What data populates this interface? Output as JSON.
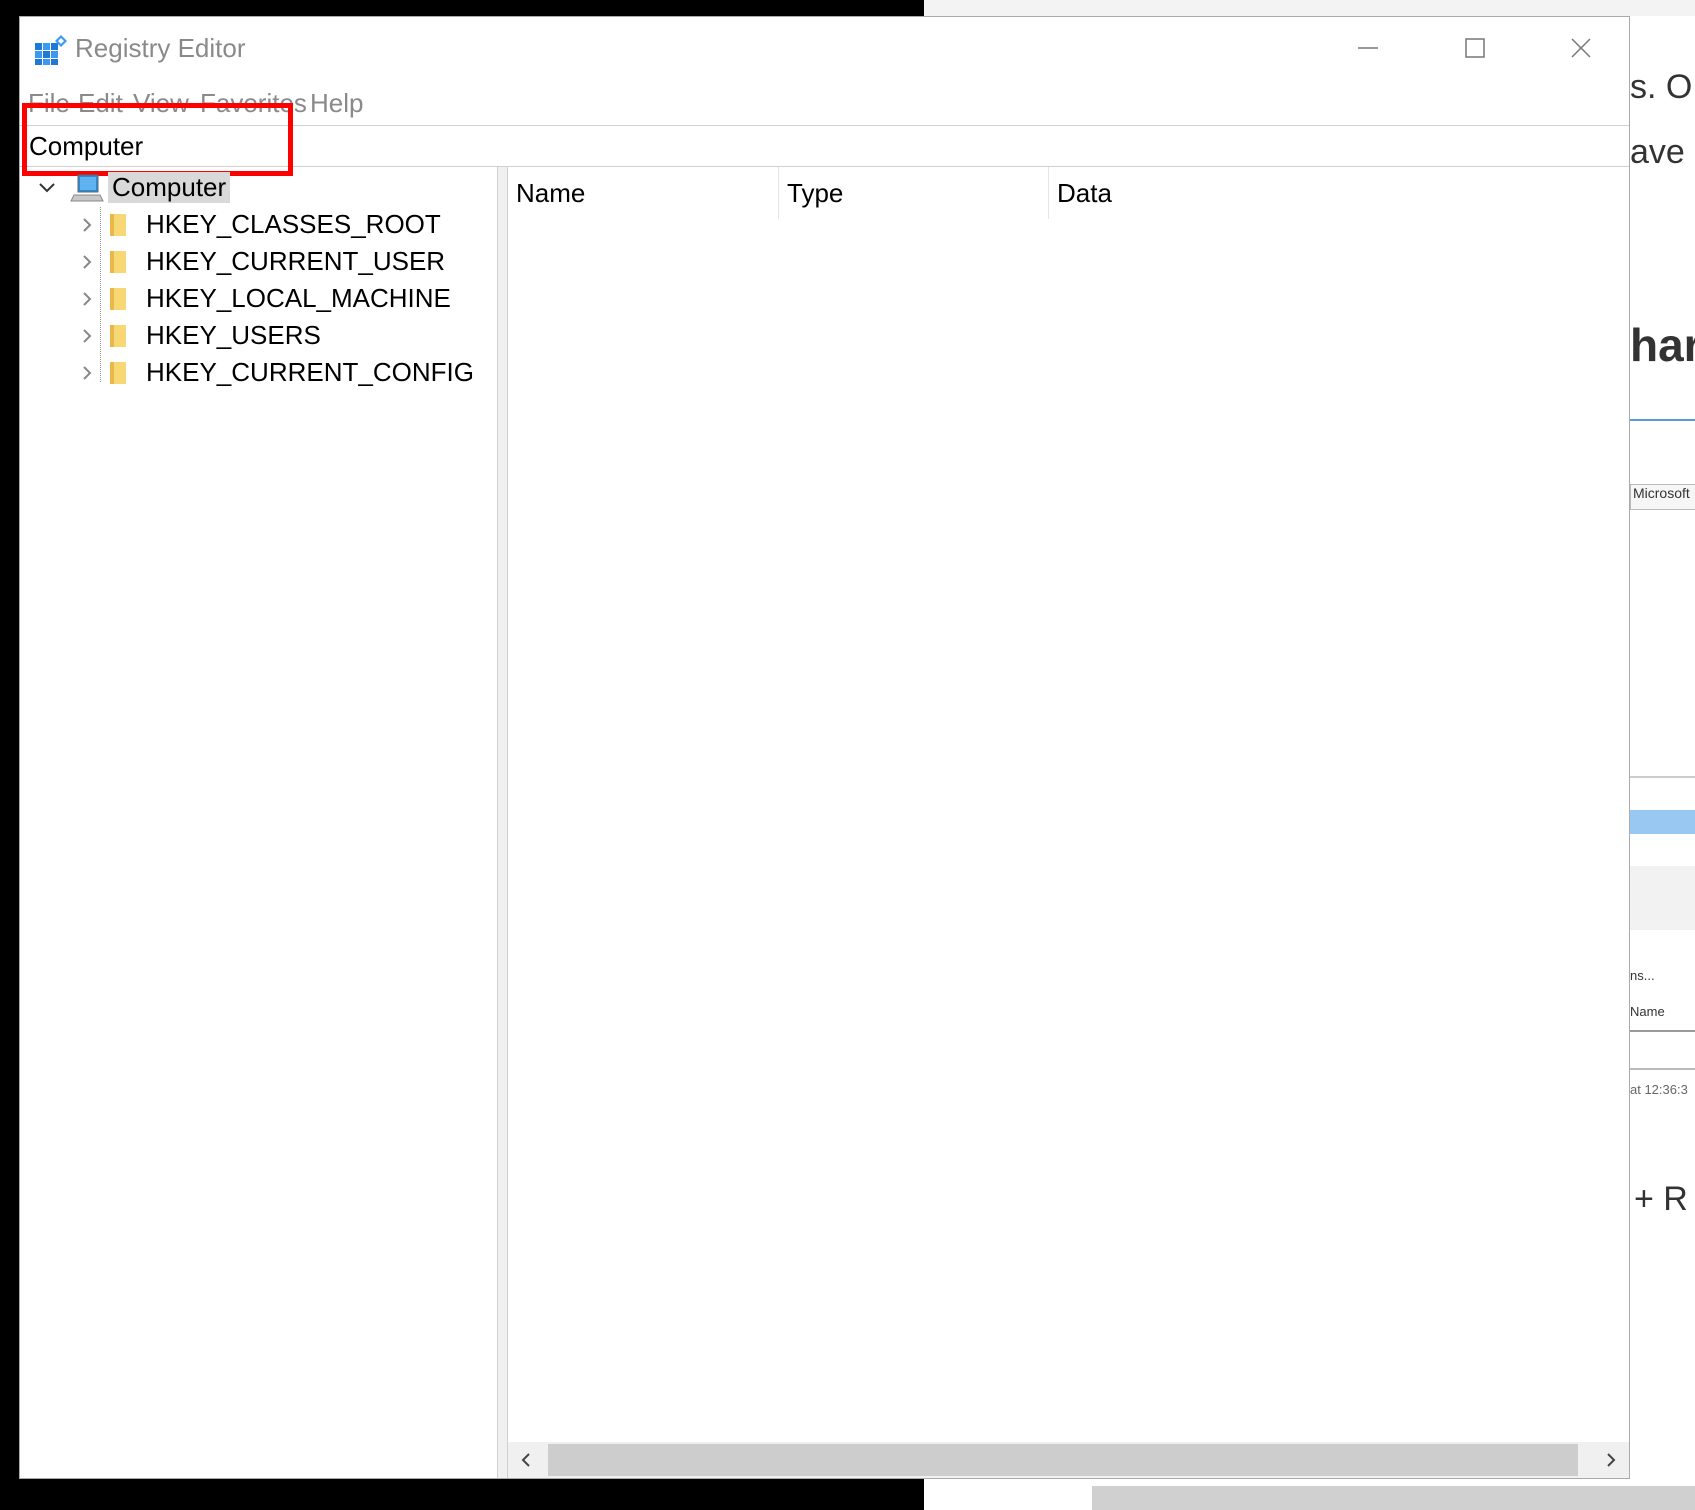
{
  "window": {
    "title": "Registry Editor"
  },
  "menu": [
    "File",
    "Edit",
    "View",
    "Favorites",
    "Help"
  ],
  "address": "Computer",
  "tree": {
    "root": "Computer",
    "children": [
      "HKEY_CLASSES_ROOT",
      "HKEY_CURRENT_USER",
      "HKEY_LOCAL_MACHINE",
      "HKEY_USERS",
      "HKEY_CURRENT_CONFIG"
    ]
  },
  "list": {
    "columns": [
      "Name",
      "Type",
      "Data"
    ]
  },
  "background": {
    "line1": "s. O",
    "line2": "ave",
    "heading": "har",
    "box": "Microsoft",
    "small1": "ns...",
    "small2": "Name",
    "small3": "at 12:36:3",
    "line4": "+ R"
  },
  "colors": {
    "highlight": "#ff0000",
    "folder": "#f8d775",
    "selection": "#d9d9d9"
  }
}
